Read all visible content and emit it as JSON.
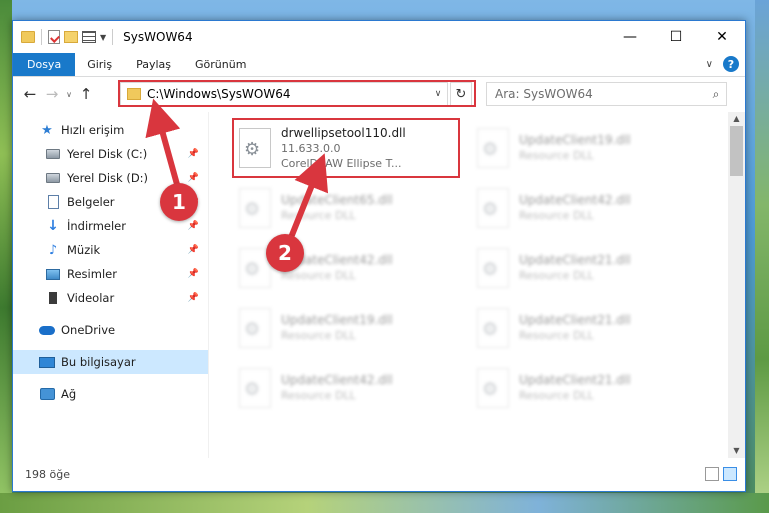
{
  "window": {
    "title": "SysWOW64"
  },
  "ribbon": {
    "tabs": [
      "Dosya",
      "Giriş",
      "Paylaş",
      "Görünüm"
    ]
  },
  "address": {
    "path": "C:\\Windows\\SysWOW64"
  },
  "search": {
    "placeholder": "Ara: SysWOW64"
  },
  "sidebar": {
    "quick_access": "Hızlı erişim",
    "items": [
      {
        "label": "Yerel Disk (C:)",
        "icon": "drive-icon",
        "pinned": true
      },
      {
        "label": "Yerel Disk (D:)",
        "icon": "drive-icon",
        "pinned": true
      },
      {
        "label": "Belgeler",
        "icon": "documents-icon",
        "pinned": true
      },
      {
        "label": "İndirmeler",
        "icon": "download-icon",
        "pinned": true
      },
      {
        "label": "Müzik",
        "icon": "music-icon",
        "pinned": true
      },
      {
        "label": "Resimler",
        "icon": "pictures-icon",
        "pinned": true
      },
      {
        "label": "Videolar",
        "icon": "videos-icon",
        "pinned": true
      }
    ],
    "onedrive": "OneDrive",
    "this_pc": "Bu bilgisayar",
    "network": "Ağ"
  },
  "files": {
    "highlighted": {
      "name": "drwellipsetool110.dll",
      "version": "11.633.0.0",
      "description": "CorelDRAW Ellipse T..."
    },
    "left_column": [
      {
        "name": "UpdateClient65.dll",
        "desc": "Resource DLL"
      },
      {
        "name": "UpdateClient42.dll",
        "desc": "Resource DLL"
      },
      {
        "name": "UpdateClient19.dll",
        "desc": "Resource DLL"
      },
      {
        "name": "UpdateClient42.dll",
        "desc": "Resource DLL"
      }
    ],
    "right_column": [
      {
        "name": "UpdateClient19.dll",
        "desc": "Resource DLL"
      },
      {
        "name": "UpdateClient42.dll",
        "desc": "Resource DLL"
      },
      {
        "name": "UpdateClient21.dll",
        "desc": "Resource DLL"
      },
      {
        "name": "UpdateClient21.dll",
        "desc": "Resource DLL"
      },
      {
        "name": "UpdateClient21.dll",
        "desc": "Resource DLL"
      }
    ]
  },
  "status": {
    "item_count": "198 öğe"
  },
  "annotations": {
    "step1": "1",
    "step2": "2",
    "color": "#d9363e"
  }
}
